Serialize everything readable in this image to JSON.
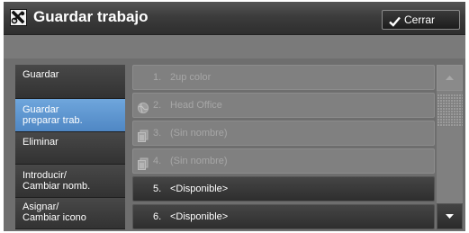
{
  "header": {
    "title": "Guardar trabajo",
    "title_icon": "tools-icon",
    "close_label": "Cerrar",
    "close_icon": "checkmark-icon"
  },
  "menu": {
    "items": [
      {
        "lines": [
          "Guardar"
        ],
        "selected": false
      },
      {
        "lines": [
          "Guardar",
          "preparar trab."
        ],
        "selected": true
      },
      {
        "lines": [
          "Eliminar"
        ],
        "selected": false
      },
      {
        "lines": [
          "Introducir/",
          "Cambiar nomb."
        ],
        "selected": false
      },
      {
        "lines": [
          "Asignar/",
          "Cambiar icono"
        ],
        "selected": false
      }
    ]
  },
  "jobs": {
    "rows": [
      {
        "num": "1.",
        "name": "2up color",
        "icon": "",
        "enabled": false
      },
      {
        "num": "2.",
        "name": "Head Office",
        "icon": "globe-icon",
        "enabled": false
      },
      {
        "num": "3.",
        "name": "(Sin nombre)",
        "icon": "document-icon",
        "enabled": false
      },
      {
        "num": "4.",
        "name": "(Sin nombre)",
        "icon": "document-icon",
        "enabled": false
      },
      {
        "num": "5.",
        "name": "<Disponible>",
        "icon": "",
        "enabled": true
      },
      {
        "num": "6.",
        "name": "<Disponible>",
        "icon": "",
        "enabled": true
      }
    ]
  },
  "scrollbar": {
    "up_icon": "arrow-up-icon",
    "down_icon": "arrow-down-icon"
  },
  "colors": {
    "selected_menu": "#5b93cf",
    "title_bar": "#3c3c3c",
    "disabled_row": "#808080",
    "active_row": "#3a3a3a"
  }
}
